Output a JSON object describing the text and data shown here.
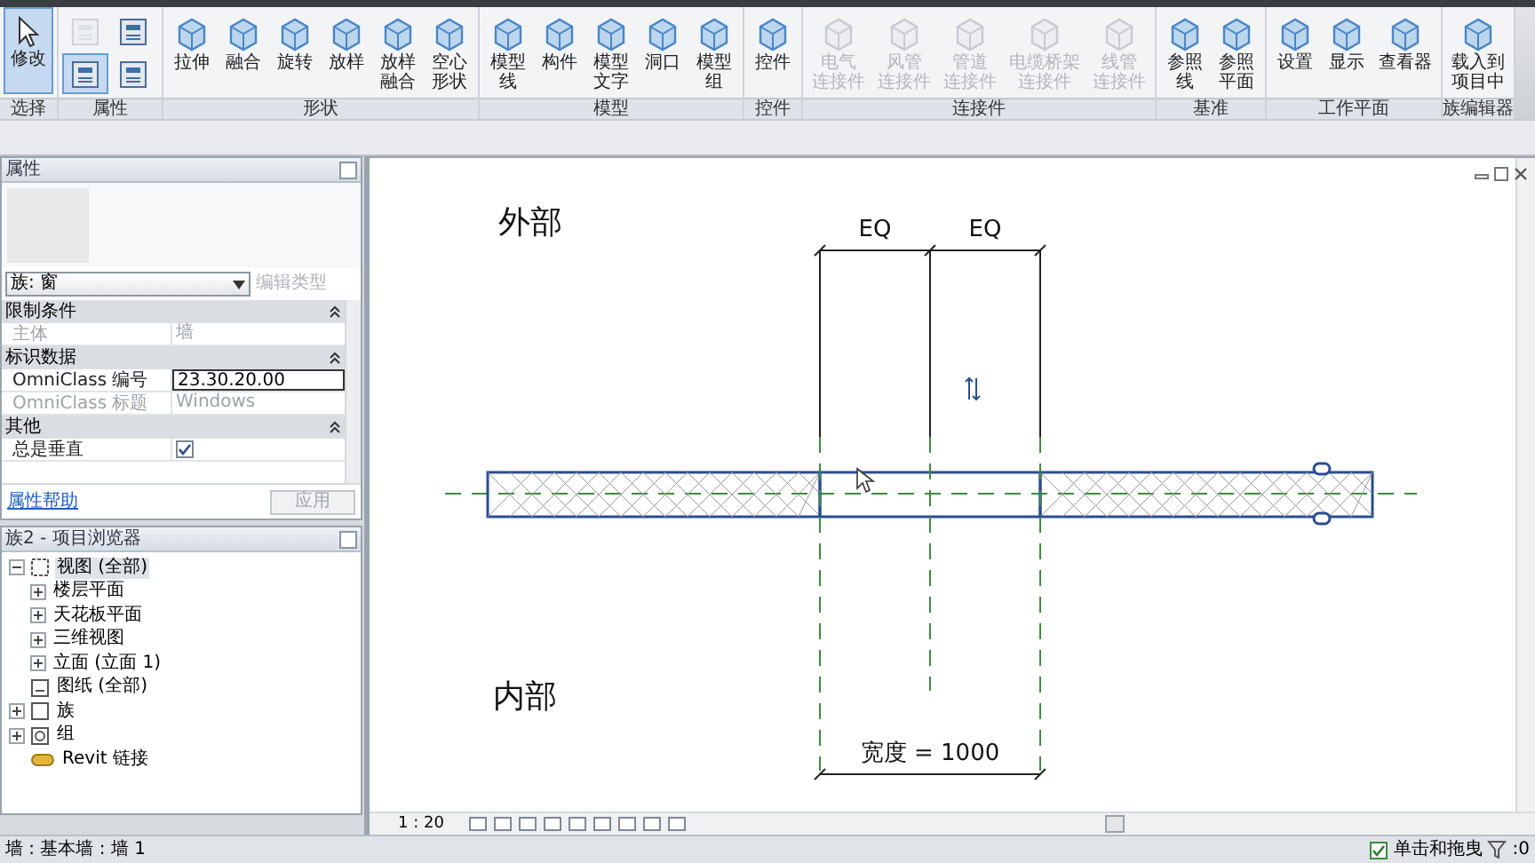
{
  "ribbon": {
    "groups": [
      {
        "label": "选择",
        "buttons": [
          {
            "kind": "large",
            "label": [
              "修改"
            ],
            "selected": true,
            "disabled": false
          }
        ]
      },
      {
        "label": "属性",
        "buttons": [
          {
            "kind": "icon",
            "selected": false,
            "disabled": true
          },
          {
            "kind": "icon",
            "selected": false,
            "disabled": false
          },
          {
            "kind": "icon",
            "selected": true,
            "disabled": false
          },
          {
            "kind": "icon",
            "selected": false,
            "disabled": false
          }
        ]
      },
      {
        "label": "形状",
        "buttons": [
          {
            "kind": "large",
            "label": [
              "拉伸"
            ],
            "selected": false,
            "disabled": false
          },
          {
            "kind": "large",
            "label": [
              "融合"
            ],
            "selected": false,
            "disabled": false
          },
          {
            "kind": "large",
            "label": [
              "旋转"
            ],
            "selected": false,
            "disabled": false
          },
          {
            "kind": "large",
            "label": [
              "放样"
            ],
            "selected": false,
            "disabled": false
          },
          {
            "kind": "large",
            "label": [
              "放样",
              "融合"
            ],
            "selected": false,
            "disabled": false
          },
          {
            "kind": "large",
            "label": [
              "空心",
              "形状"
            ],
            "selected": false,
            "disabled": false
          }
        ]
      },
      {
        "label": "模型",
        "buttons": [
          {
            "kind": "large",
            "label": [
              "模型",
              "线"
            ],
            "selected": false,
            "disabled": false
          },
          {
            "kind": "large",
            "label": [
              "构件"
            ],
            "selected": false,
            "disabled": false
          },
          {
            "kind": "large",
            "label": [
              "模型",
              "文字"
            ],
            "selected": false,
            "disabled": false
          },
          {
            "kind": "large",
            "label": [
              "洞口"
            ],
            "selected": false,
            "disabled": false
          },
          {
            "kind": "large",
            "label": [
              "模型",
              "组"
            ],
            "selected": false,
            "disabled": false
          }
        ]
      },
      {
        "label": "控件",
        "buttons": [
          {
            "kind": "large",
            "label": [
              "控件"
            ],
            "selected": false,
            "disabled": false
          }
        ]
      },
      {
        "label": "连接件",
        "buttons": [
          {
            "kind": "large",
            "label": [
              "电气",
              "连接件"
            ],
            "selected": false,
            "disabled": true
          },
          {
            "kind": "large",
            "label": [
              "风管",
              "连接件"
            ],
            "selected": false,
            "disabled": true
          },
          {
            "kind": "large",
            "label": [
              "管道",
              "连接件"
            ],
            "selected": false,
            "disabled": true
          },
          {
            "kind": "large",
            "label": [
              "电缆桥架",
              "连接件"
            ],
            "selected": false,
            "disabled": true
          },
          {
            "kind": "large",
            "label": [
              "线管",
              "连接件"
            ],
            "selected": false,
            "disabled": true
          }
        ]
      },
      {
        "label": "基准",
        "buttons": [
          {
            "kind": "large",
            "label": [
              "参照",
              "线"
            ],
            "selected": false,
            "disabled": false
          },
          {
            "kind": "large",
            "label": [
              "参照",
              "平面"
            ],
            "selected": false,
            "disabled": false
          }
        ]
      },
      {
        "label": "工作平面",
        "buttons": [
          {
            "kind": "large",
            "label": [
              "设置"
            ],
            "selected": false,
            "disabled": false
          },
          {
            "kind": "large",
            "label": [
              "显示"
            ],
            "selected": false,
            "disabled": false
          },
          {
            "kind": "large",
            "label": [
              "查看器"
            ],
            "selected": false,
            "disabled": false
          }
        ]
      },
      {
        "label": "族编辑器",
        "buttons": [
          {
            "kind": "large",
            "label": [
              "载入到",
              "项目中"
            ],
            "selected": false,
            "disabled": false
          }
        ]
      }
    ]
  },
  "properties": {
    "title": "属性",
    "type_selector": "族: 窗",
    "edit_type": {
      "label": "编辑类型",
      "disabled": true
    },
    "rows": [
      {
        "kind": "section",
        "label": "限制条件",
        "expanded": true
      },
      {
        "kind": "text",
        "label": "主体",
        "value": "墙",
        "disabled": true
      },
      {
        "kind": "section",
        "label": "标识数据",
        "expanded": true
      },
      {
        "kind": "field",
        "label": "OmniClass 编号",
        "value": "23.30.20.00"
      },
      {
        "kind": "text",
        "label": "OmniClass 标题",
        "value": "Windows",
        "disabled": true
      },
      {
        "kind": "section",
        "label": "其他",
        "expanded": true
      },
      {
        "kind": "checkbox",
        "label": "总是垂直",
        "checked": true
      }
    ],
    "help_link": "属性帮助",
    "apply": {
      "label": "应用",
      "disabled": true
    }
  },
  "browser": {
    "title": "族2 - 项目浏览器",
    "tree": [
      {
        "label": "视图 (全部)",
        "expanded": true,
        "selected": true,
        "children": [
          {
            "label": "楼层平面",
            "expanded": false,
            "selected": false
          },
          {
            "label": "天花板平面",
            "expanded": false,
            "selected": false
          },
          {
            "label": "三维视图",
            "expanded": false,
            "selected": false
          },
          {
            "label": "立面 (立面 1)",
            "expanded": false,
            "selected": false
          }
        ]
      },
      {
        "label": "图纸 (全部)",
        "selected": false
      },
      {
        "label": "族",
        "expanded": false,
        "selected": false
      },
      {
        "label": "组",
        "expanded": false,
        "selected": false
      },
      {
        "label": "Revit 链接",
        "selected": false
      }
    ]
  },
  "canvas": {
    "label_top": "外部",
    "label_bottom": "内部",
    "eq_labels": [
      "EQ",
      "EQ"
    ],
    "width_dimension": "宽度 = 1000",
    "scale": "1 : 20"
  },
  "status_bar": {
    "text": "墙 : 基本墙 : 墙 1",
    "click_drag": {
      "label": "单击和拖曳",
      "checked": true
    },
    "filter_count": ":0"
  }
}
